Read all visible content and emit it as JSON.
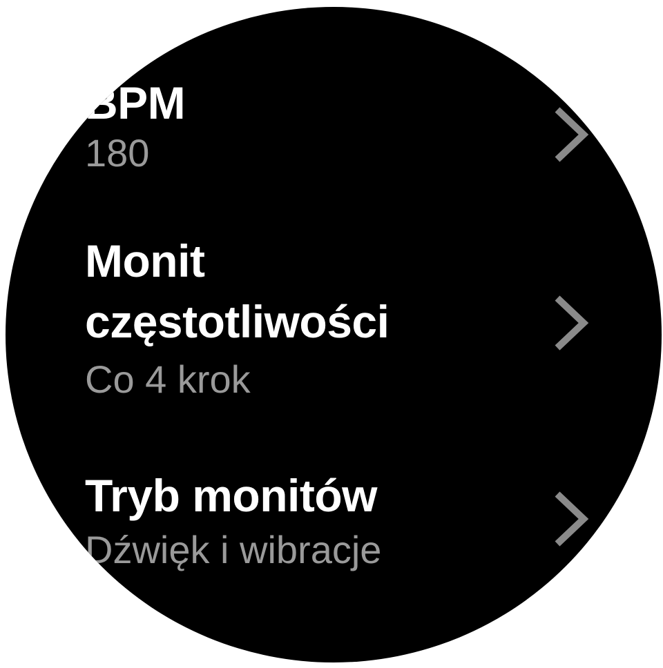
{
  "settings": {
    "items": [
      {
        "title": "BPM",
        "value": "180"
      },
      {
        "title_line1": "Monit",
        "title_line2": "częstotliwości",
        "value": "Co 4 krok"
      },
      {
        "title": "Tryb monitów",
        "value": "Dźwięk i wibracje"
      }
    ]
  },
  "icons": {
    "chevron": "chevron-right-icon"
  },
  "colors": {
    "background": "#000000",
    "title": "#ffffff",
    "value": "#9a9a9a",
    "chevron": "#8a8a8a"
  }
}
